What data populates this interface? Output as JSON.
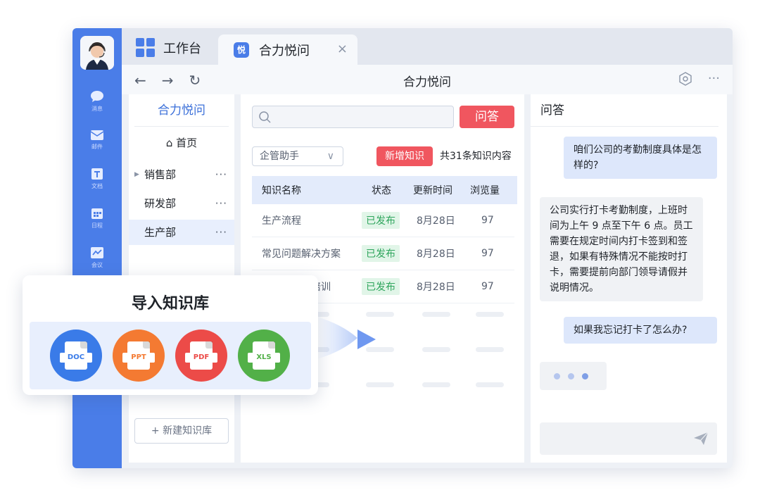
{
  "tabs": {
    "workbench": "工作台",
    "app": "合力悦问",
    "app_icon_glyph": "悦",
    "close": "×"
  },
  "navbar": {
    "title": "合力悦问",
    "more": "···"
  },
  "rail": [
    {
      "label": "消息",
      "icon": "chat-icon"
    },
    {
      "label": "邮件",
      "icon": "mail-icon"
    },
    {
      "label": "文档",
      "icon": "doc-icon"
    },
    {
      "label": "日程",
      "icon": "calendar-icon"
    },
    {
      "label": "会议",
      "icon": "meeting-icon"
    }
  ],
  "left_panel": {
    "title": "合力悦问",
    "home": "⌂ 首页",
    "items": [
      {
        "label": "销售部",
        "more": "···"
      },
      {
        "label": "研发部",
        "more": "···"
      },
      {
        "label": "生产部",
        "more": "···"
      }
    ],
    "new_kb": "+ 新建知识库"
  },
  "middle": {
    "search_placeholder": "",
    "qa_button": "问答",
    "select_value": "企管助手",
    "add_button": "新增知识",
    "count_text": "共31条知识内容",
    "columns": [
      "知识名称",
      "状态",
      "更新时间",
      "浏览量"
    ],
    "rows": [
      {
        "name": "生产流程",
        "status": "已发布",
        "date": "8月28日",
        "views": "97"
      },
      {
        "name": "常见问题解决方案",
        "status": "已发布",
        "date": "8月28日",
        "views": "97"
      },
      {
        "name": "培训",
        "status": "已发布",
        "date": "8月28日",
        "views": "97"
      }
    ]
  },
  "chat": {
    "title": "问答",
    "messages": [
      {
        "role": "user",
        "text": "咱们公司的考勤制度具体是怎样的?"
      },
      {
        "role": "bot",
        "text": "公司实行打卡考勤制度，上班时间为上午 9 点至下午 6 点。员工需要在规定时间内打卡签到和签退，如果有特殊情况不能按时打卡，需要提前向部门领导请假并说明情况。"
      },
      {
        "role": "user",
        "text": "如果我忘记打卡了怎么办?"
      }
    ]
  },
  "import_card": {
    "title": "导入知识库",
    "files": [
      {
        "label": "DOC",
        "color": "#3a7be8"
      },
      {
        "label": "PPT",
        "color": "#f47a32"
      },
      {
        "label": "PDF",
        "color": "#ec4b48"
      },
      {
        "label": "XLS",
        "color": "#52b048"
      }
    ]
  }
}
